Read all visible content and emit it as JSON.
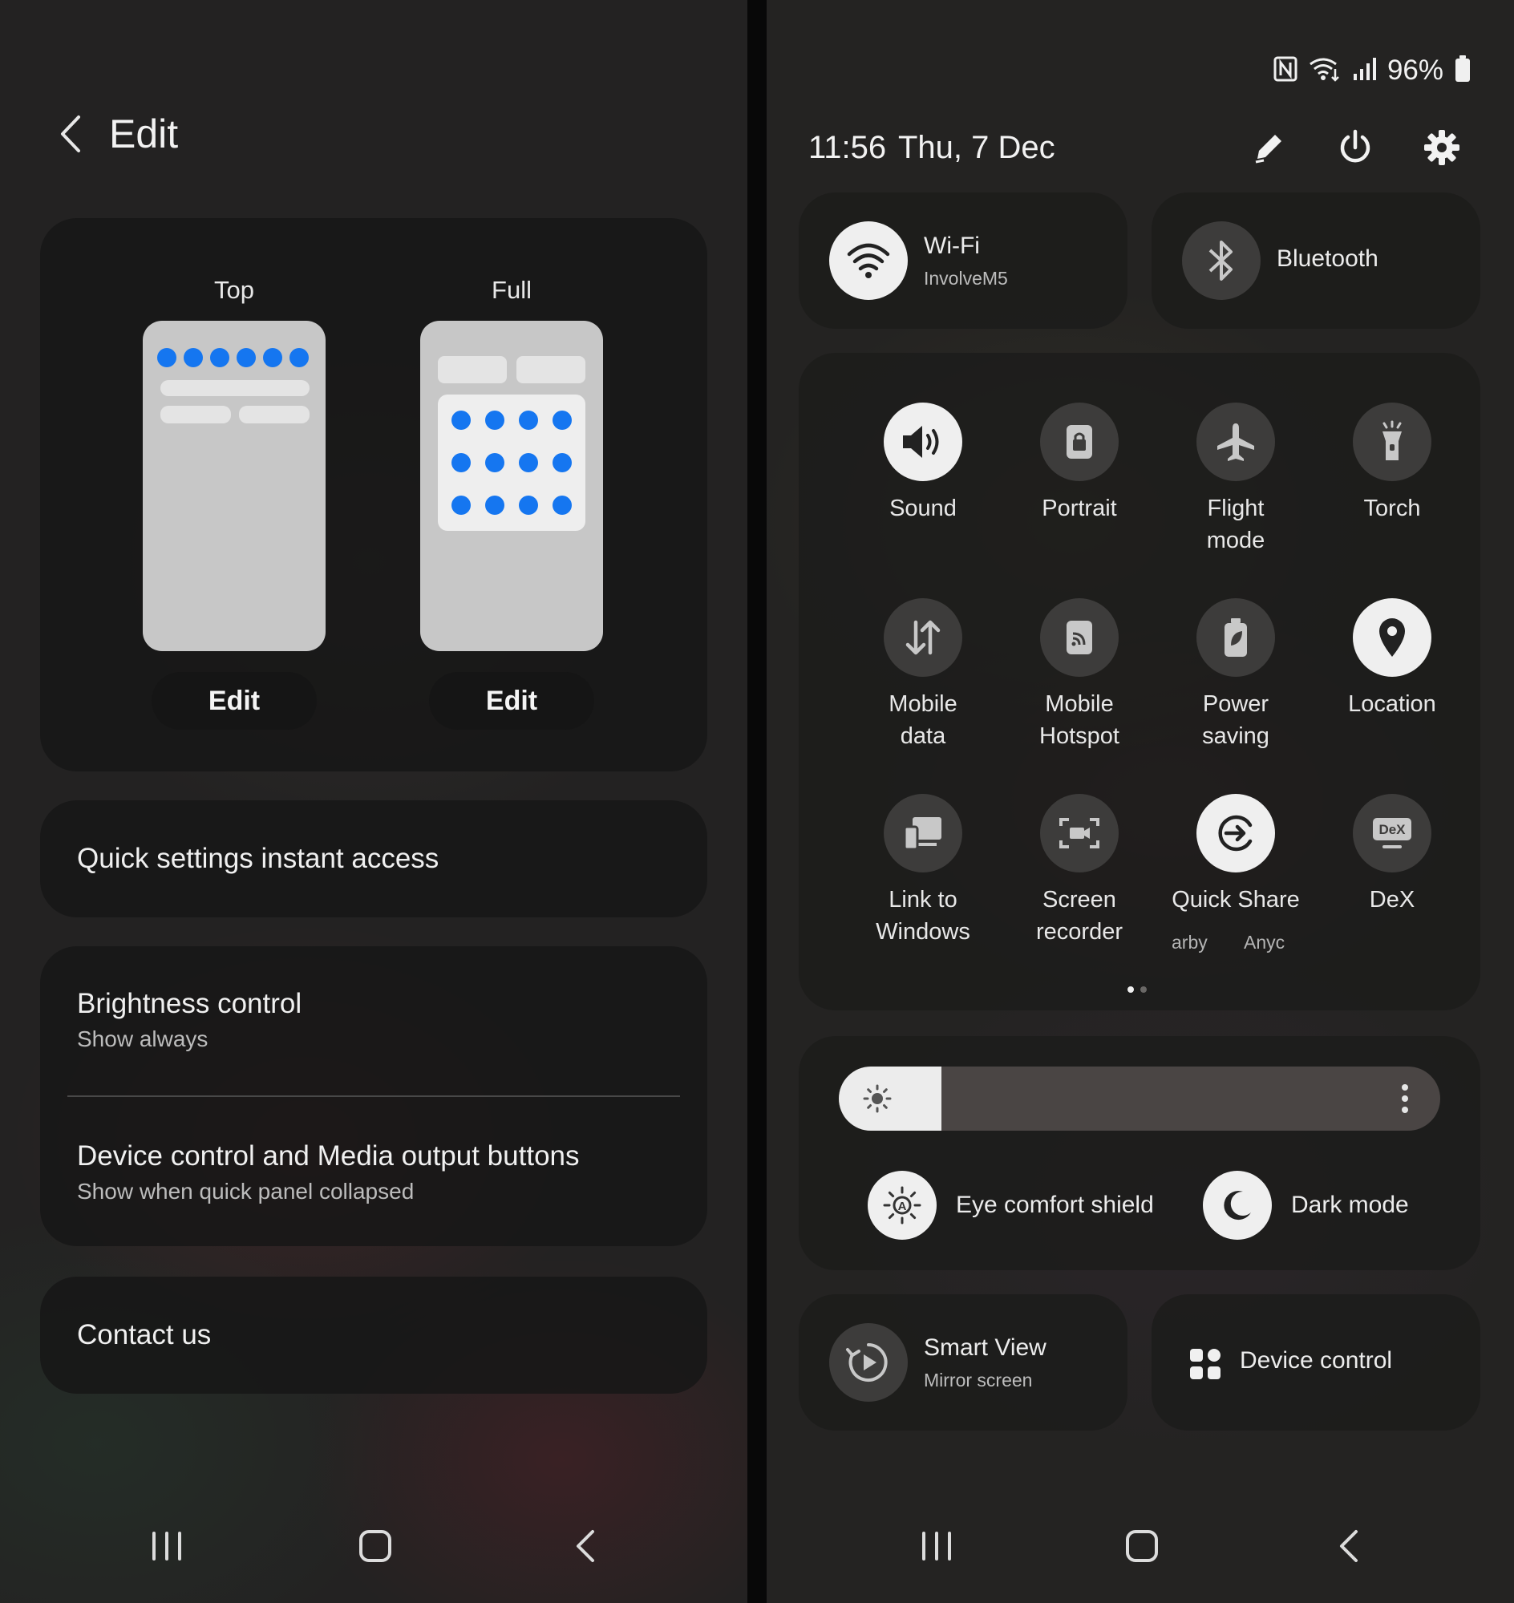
{
  "left": {
    "title": "Edit",
    "layouts": [
      {
        "label": "Top",
        "button": "Edit"
      },
      {
        "label": "Full",
        "button": "Edit"
      }
    ],
    "quick_settings_instant_access": "Quick settings instant access",
    "brightness": {
      "title": "Brightness control",
      "value": "Show always"
    },
    "device_media": {
      "title": "Device control and Media output buttons",
      "value": "Show when quick panel collapsed"
    },
    "contact": "Contact us"
  },
  "right": {
    "status": {
      "battery": "96%",
      "icons": [
        "nfc-icon",
        "wifi-calling-icon",
        "signal-icon",
        "battery-icon"
      ]
    },
    "time": "11:56",
    "date": "Thu, 7 Dec",
    "wifi": {
      "title": "Wi-Fi",
      "network": "InvolveM5",
      "on": true
    },
    "bluetooth": {
      "title": "Bluetooth",
      "on": false
    },
    "tiles": [
      {
        "label": "Sound",
        "icon": "sound-icon",
        "on": true
      },
      {
        "label": "Portrait",
        "icon": "portrait-lock-icon",
        "on": false
      },
      {
        "label": "Flight\nmode",
        "icon": "airplane-icon",
        "on": false
      },
      {
        "label": "Torch",
        "icon": "torch-icon",
        "on": false
      },
      {
        "label": "Mobile\ndata",
        "icon": "mobile-data-icon",
        "on": false
      },
      {
        "label": "Mobile\nHotspot",
        "icon": "hotspot-icon",
        "on": false
      },
      {
        "label": "Power\nsaving",
        "icon": "power-saving-icon",
        "on": false
      },
      {
        "label": "Location",
        "icon": "location-pin-icon",
        "on": true
      },
      {
        "label": "Link to\nWindows",
        "icon": "link-to-windows-icon",
        "on": false
      },
      {
        "label": "Screen\nrecorder",
        "icon": "screen-recorder-icon",
        "on": false
      },
      {
        "label": "Quick Share",
        "icon": "quick-share-icon",
        "on": true
      },
      {
        "label": "DeX",
        "icon": "dex-icon",
        "on": false
      }
    ],
    "quick_share_sub": [
      "arby",
      "Anyc"
    ],
    "page_count": 2,
    "active_page": 1,
    "brightness_level": 0.17,
    "eye_comfort": "Eye comfort shield",
    "dark_mode": "Dark mode",
    "smart_view": {
      "title": "Smart View",
      "sub": "Mirror screen"
    },
    "device_control": "Device control",
    "dex_badge": "DeX"
  },
  "colors": {
    "accent": "#1576f0",
    "tile_on": "#efefef",
    "tile_off": "#3d3c3b"
  }
}
